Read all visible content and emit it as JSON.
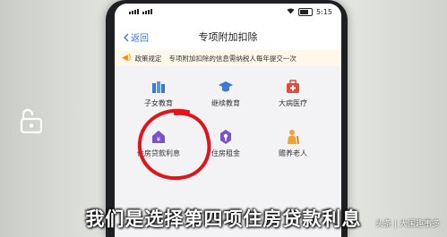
{
  "status_bar": {
    "carrier": "",
    "time": "5:15"
  },
  "header": {
    "back_label": "返回",
    "title": "专项附加扣除"
  },
  "notice": {
    "label": "政策规定",
    "text": "专项附加扣除的信息需纳税人每年提交一次"
  },
  "categories": [
    {
      "label": "子女教育",
      "icon": "children-education-icon",
      "color": "#3a77d9"
    },
    {
      "label": "继续教育",
      "icon": "graduation-cap-icon",
      "color": "#3a77d9"
    },
    {
      "label": "大病医疗",
      "icon": "medical-kit-icon",
      "color": "#e34a3a"
    },
    {
      "label": "住房贷款利息",
      "icon": "house-loan-icon",
      "color": "#7a52c9"
    },
    {
      "label": "住房租金",
      "icon": "house-rent-icon",
      "color": "#7a52c9"
    },
    {
      "label": "赡养老人",
      "icon": "elderly-care-icon",
      "color": "#f0a23a"
    }
  ],
  "overlay": {
    "subtitle": "我们是选择第四项住房贷款利息",
    "watermark": "头条 | 大国趣事多"
  },
  "colors": {
    "accent": "#3a77d9",
    "marker": "#e0141b"
  }
}
